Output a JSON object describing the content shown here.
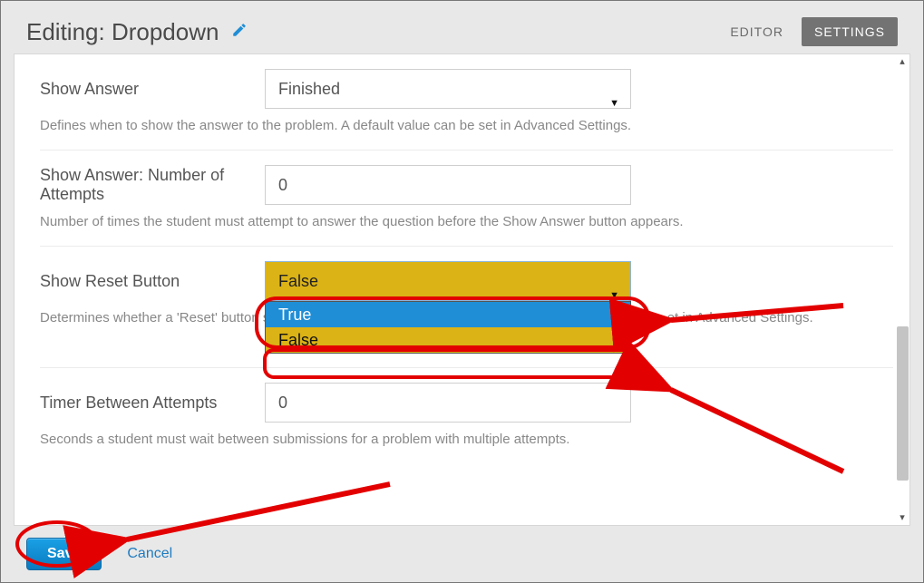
{
  "header": {
    "title": "Editing: Dropdown",
    "tabs": {
      "editor": "EDITOR",
      "settings": "SETTINGS"
    }
  },
  "settings": {
    "show_answer": {
      "label": "Show Answer",
      "value": "Finished",
      "help": "Defines when to show the answer to the problem. A default value can be set in Advanced Settings."
    },
    "show_answer_attempts": {
      "label": "Show Answer: Number of Attempts",
      "value": "0",
      "help": "Number of times the student must attempt to answer the question before the Show Answer button appears."
    },
    "show_reset": {
      "label": "Show Reset Button",
      "value": "False",
      "options": [
        "True",
        "False"
      ],
      "help_prefix": "Determines whether a 'Reset' button s",
      "help_suffix": "et in Advanced Settings."
    },
    "timer": {
      "label": "Timer Between Attempts",
      "value": "0",
      "help": "Seconds a student must wait between submissions for a problem with multiple attempts."
    }
  },
  "footer": {
    "save": "Save",
    "cancel": "Cancel"
  },
  "colors": {
    "accent": "#1f8ed6",
    "highlight_yellow": "#dbb316",
    "anno_red": "#e30000",
    "tab_active_bg": "#737373"
  }
}
